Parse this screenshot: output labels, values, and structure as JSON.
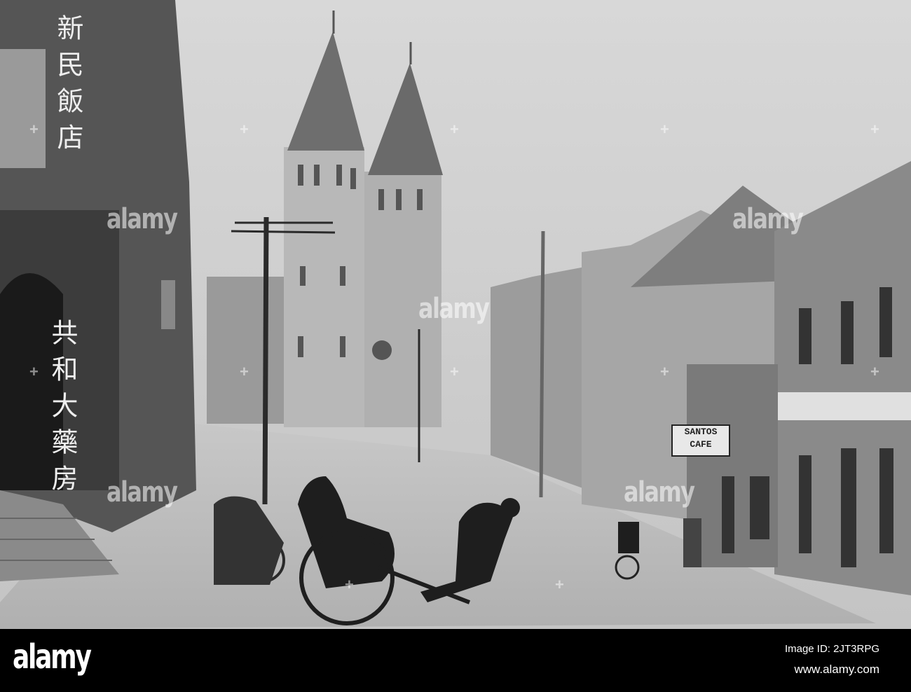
{
  "photo": {
    "hotel_sign": "新民飯店",
    "pharmacy_sign": "共和大藥房",
    "cafe_sign_line1": "SANTOS",
    "cafe_sign_line2": "CAFE"
  },
  "watermark": "alamy",
  "footer": {
    "logo": "alamy",
    "image_id": "Image ID: 2JT3RPG",
    "website": "www.alamy.com"
  }
}
